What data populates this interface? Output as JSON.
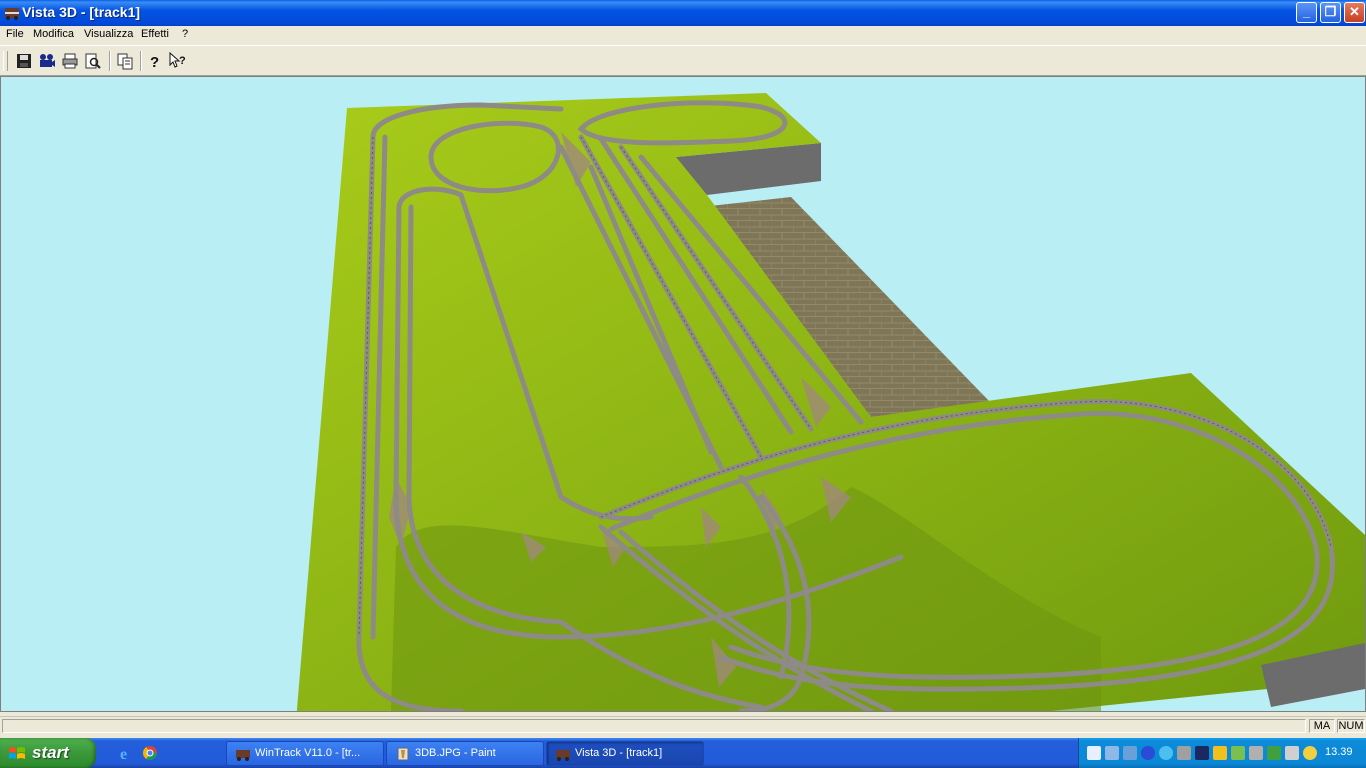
{
  "window": {
    "title": "Vista 3D - [track1]",
    "buttons": {
      "minimize": "_",
      "maximize": "❐",
      "close": "✕"
    }
  },
  "menu": {
    "items": [
      "File",
      "Modifica",
      "Visualizza",
      "Effetti",
      "?"
    ]
  },
  "toolbar": {
    "buttons": [
      {
        "name": "save",
        "icon": "floppy-disk-icon"
      },
      {
        "name": "camera",
        "icon": "film-camera-icon"
      },
      {
        "name": "print",
        "icon": "printer-icon"
      },
      {
        "name": "print-preview",
        "icon": "print-preview-icon"
      },
      {
        "name": "copy",
        "icon": "copy-icon"
      },
      {
        "name": "help",
        "icon": "question-icon"
      },
      {
        "name": "context-help",
        "icon": "context-help-icon"
      }
    ]
  },
  "viewport": {
    "colors": {
      "sky": "#b8eef4",
      "grass": "#8ab512",
      "track": "#8e8a86",
      "cliff": "#6e6e6e",
      "floor": "#7d7458"
    }
  },
  "statusbar": {
    "panes": [
      "",
      "MA",
      "NUM"
    ]
  },
  "taskbar": {
    "start_label": "start",
    "quick_launch": [
      "internet-explorer-icon",
      "chrome-icon"
    ],
    "tasks": [
      {
        "label": "WinTrack  V11.0 - [tr...",
        "icon": "wintrack-icon",
        "active": false
      },
      {
        "label": "3DB.JPG - Paint",
        "icon": "paint-icon",
        "active": false
      },
      {
        "label": "Vista 3D - [track1]",
        "icon": "wintrack-icon",
        "active": true
      }
    ],
    "clock": "13.39"
  }
}
